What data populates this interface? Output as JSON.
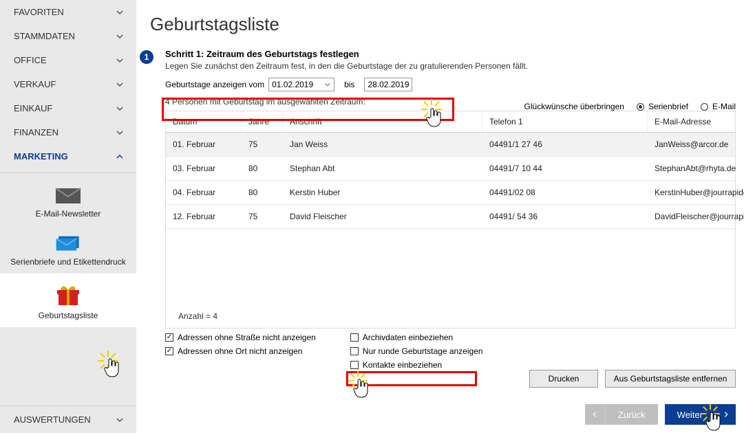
{
  "sidebar": {
    "items": [
      "FAVORITEN",
      "STAMMDATEN",
      "OFFICE",
      "VERKAUF",
      "EINKAUF",
      "FINANZEN",
      "MARKETING"
    ],
    "bottom": "AUSWERTUNGEN",
    "sub": {
      "newsletter": "E-Mail-Newsletter",
      "serien": "Serienbriefe und Etikettendruck",
      "birthday": "Geburtstagsliste"
    }
  },
  "page": {
    "title": "Geburtstagsliste",
    "step_num": "1",
    "step_title": "Schritt 1: Zeitraum des Geburtstags festlegen",
    "step_desc": "Legen Sie zunächst den Zeitraum fest, in den die Geburtstage der zu gratulierenden Personen fällt.",
    "range_label": "Geburtstage anzeigen vom",
    "date_from": "01.02.2019",
    "bis": "bis",
    "date_to": "28.02.2019",
    "delivery_label": "Glückwünsche überbringen",
    "radio_serien": "Serienbrief",
    "radio_email": "E-Mail",
    "count_text": "4 Personen mit Geburtstag im ausgewählten Zeitraum:",
    "footer_count": "Anzahl = 4"
  },
  "columns": [
    "Datum",
    "Jahre",
    "Anschrift",
    "Telefon 1",
    "E-Mail-Adresse"
  ],
  "rows": [
    {
      "datum": "01. Februar",
      "jahre": "75",
      "anschrift": "Jan Weiss",
      "tel": "04491/1 27 46",
      "email": "JanWeiss@arcor.de"
    },
    {
      "datum": "03. Februar",
      "jahre": "80",
      "anschrift": "Stephan Abt",
      "tel": "04491/7 10 44",
      "email": "StephanAbt@rhyta.de"
    },
    {
      "datum": "04. Februar",
      "jahre": "80",
      "anschrift": "Kerstin Huber",
      "tel": "04491/02 08",
      "email": "KerstinHuber@jourrapide.de"
    },
    {
      "datum": "12. Februar",
      "jahre": "75",
      "anschrift": "David Fleischer",
      "tel": "04491/ 54 36",
      "email": "DavidFleischer@jourrapide.de"
    }
  ],
  "options": {
    "no_street": "Adressen ohne Straße nicht anzeigen",
    "no_city": "Adressen ohne Ort nicht anzeigen",
    "archive": "Archivdaten einbeziehen",
    "round": "Nur runde Geburtstage anzeigen",
    "contacts": "Kontakte einbeziehen"
  },
  "buttons": {
    "print": "Drucken",
    "remove": "Aus Geburtstagsliste entfernen",
    "back": "Zurück",
    "next": "Weiter"
  }
}
